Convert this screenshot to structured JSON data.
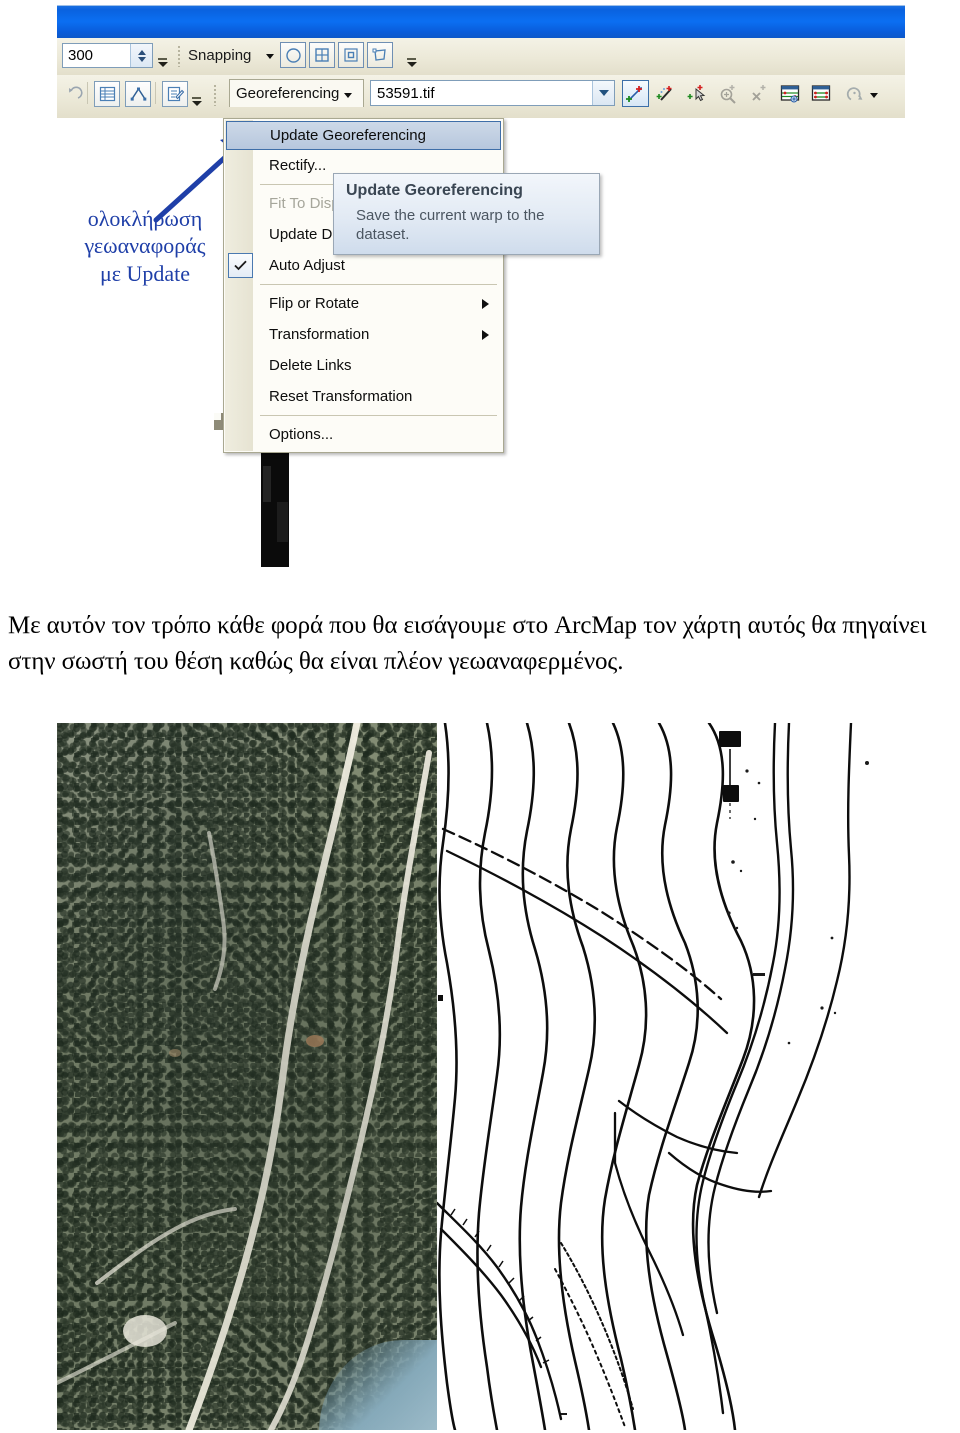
{
  "document": {
    "paragraph": "Με αυτόν τον τρόπο κάθε φορά που θα εισάγουμε στο ArcMap τον χάρτη αυτός θα πηγαίνει στην σωστή του θέση καθώς θα είναι πλέον γεωαναφερμένος."
  },
  "annotation": {
    "line1": "ολοκλήρωση",
    "line2": "γεωαναφοράς",
    "line3": "με Update",
    "color": "#1f3fa8",
    "arrow_icon": "arrow-up-right-icon"
  },
  "arcmap": {
    "titlebar": {
      "title": "",
      "color": "#0b6ff2"
    },
    "snapping_toolbar": {
      "spinner_value": "300",
      "spinner_up_icon": "chevron-up-icon",
      "spinner_down_icon": "chevron-down-icon",
      "menu_label": "Snapping",
      "menu_caret_icon": "chevron-down-icon",
      "buttons": [
        {
          "name": "snap-to-vertex-button",
          "icon": "circle-icon",
          "active": true
        },
        {
          "name": "snap-to-edge-button",
          "icon": "grid-square-icon",
          "active": true
        },
        {
          "name": "snap-to-endpoint-button",
          "icon": "square-outline-icon",
          "active": true
        },
        {
          "name": "snap-to-intersection-button",
          "icon": "polygon-icon",
          "active": true
        }
      ],
      "overflow_icon": "toolbar-overflow-icon"
    },
    "editor_toolbar": {
      "buttons": [
        {
          "name": "undo-button",
          "icon": "undo-arrow-icon"
        },
        {
          "name": "attributes-button",
          "icon": "table-rows-icon"
        },
        {
          "name": "sketch-properties-button",
          "icon": "triangle-vertices-icon"
        },
        {
          "name": "edit-sketch-button",
          "icon": "form-pencil-icon"
        }
      ],
      "overflow_icon": "toolbar-overflow-icon"
    },
    "georeferencing_toolbar": {
      "menu_label": "Georeferencing",
      "menu_caret_icon": "chevron-down-icon",
      "layer_combo": {
        "value": "53591.tif",
        "arrow_icon": "chevron-down-icon"
      },
      "tools": [
        {
          "name": "add-control-points-button",
          "icon": "control-point-arrow-icon",
          "active": true
        },
        {
          "name": "auto-registration-button",
          "icon": "magic-wand-point-icon",
          "active": false
        },
        {
          "name": "select-link-button",
          "icon": "cursor-point-icon",
          "active": false
        },
        {
          "name": "zoom-to-link-button",
          "icon": "magnifier-plus-point-icon",
          "active": false,
          "disabled": true
        },
        {
          "name": "delete-link-button",
          "icon": "delete-point-icon",
          "active": false,
          "disabled": true
        },
        {
          "name": "view-link-table-button",
          "icon": "link-table-icon",
          "active": false
        },
        {
          "name": "link-table-2-button",
          "icon": "link-table-alt-icon",
          "active": false
        },
        {
          "name": "rotate-button",
          "icon": "rotate-icon",
          "active": false
        },
        {
          "name": "rotate-dropdown",
          "icon": "chevron-down-icon",
          "active": false
        }
      ]
    },
    "dropdown_menu": {
      "items": [
        {
          "label": "Update Georeferencing",
          "state": "selected",
          "name": "menu-item-update-georeferencing"
        },
        {
          "label": "Rectify...",
          "state": "normal",
          "name": "menu-item-rectify"
        },
        {
          "separator": true
        },
        {
          "label": "Fit To Display",
          "state": "disabled",
          "name": "menu-item-fit-to-display"
        },
        {
          "label": "Update Display",
          "state": "normal",
          "name": "menu-item-update-display"
        },
        {
          "label": "Auto Adjust",
          "state": "checked",
          "checked_icon": "checkmark-icon",
          "name": "menu-item-auto-adjust"
        },
        {
          "separator": true
        },
        {
          "label": "Flip or Rotate",
          "state": "submenu",
          "submenu_icon": "chevron-right-icon",
          "name": "menu-item-flip-or-rotate"
        },
        {
          "label": "Transformation",
          "state": "submenu",
          "submenu_icon": "chevron-right-icon",
          "name": "menu-item-transformation"
        },
        {
          "label": "Delete Links",
          "state": "normal",
          "name": "menu-item-delete-links"
        },
        {
          "label": "Reset Transformation",
          "state": "normal",
          "name": "menu-item-reset-transformation"
        },
        {
          "separator": true
        },
        {
          "label": "Options...",
          "state": "normal",
          "name": "menu-item-options"
        }
      ]
    },
    "tooltip": {
      "title": "Update Georeferencing",
      "body": "Save the current warp to the dataset."
    }
  },
  "figure": {
    "left_panel_name": "aerial-photo",
    "right_panel_name": "scanned-topographic-map"
  }
}
